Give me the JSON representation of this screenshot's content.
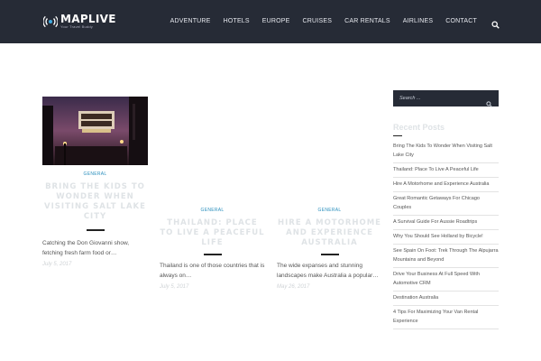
{
  "brand": {
    "name": "MAPLIVE",
    "tagline": "Your Travel Buddy"
  },
  "nav": {
    "items": [
      {
        "label": "ADVENTURE"
      },
      {
        "label": "HOTELS"
      },
      {
        "label": "EUROPE"
      },
      {
        "label": "CRUISES"
      },
      {
        "label": "CAR RENTALS"
      },
      {
        "label": "AIRLINES"
      },
      {
        "label": "CONTACT"
      }
    ],
    "search_icon": "search-icon"
  },
  "posts": [
    {
      "category": "GENERAL",
      "title": "BRING THE KIDS TO WONDER WHEN VISITING SALT LAKE CITY",
      "excerpt": "Catching the Don Giovanni show, fetching fresh farm food or…",
      "date": "July 5, 2017",
      "image": "theater-marquee-photo"
    },
    {
      "category": "GENERAL",
      "title": "THAILAND: PLACE TO LIVE A PEACEFUL LIFE",
      "excerpt": "Thailand is one of those countries that is always on…",
      "date": "July 5, 2017"
    },
    {
      "category": "GENERAL",
      "title": "HIRE A MOTORHOME AND EXPERIENCE AUSTRALIA",
      "excerpt": "The wide expanses and stunning landscapes make Australia a popular…",
      "date": "May 26, 2017"
    }
  ],
  "sidebar": {
    "search_placeholder": "Search ...",
    "recent_title": "Recent Posts",
    "recent_posts": [
      "Bring The Kids To Wonder When Visiting Salt Lake City",
      "Thailand: Place To Live A Peaceful Life",
      "Hire A Motorhome and Experience Australia",
      "Great Romantic Getaways For Chicago Couples",
      "A Survival Guide For Aussie Roadtrips",
      "Why You Should See Holland by Bicycle!",
      "See Spain On Foot: Trek Through The Alpujarra Mountains and Beyond",
      "Drive Your Business At Full Speed With Automotive CRM",
      "Destination Australia",
      "4 Tips For Maximizing Your Van Rental Experience"
    ]
  },
  "colors": {
    "header_bg": "#262b36",
    "accent": "#2a8fbd",
    "title_faded": "#dfe3e6"
  }
}
